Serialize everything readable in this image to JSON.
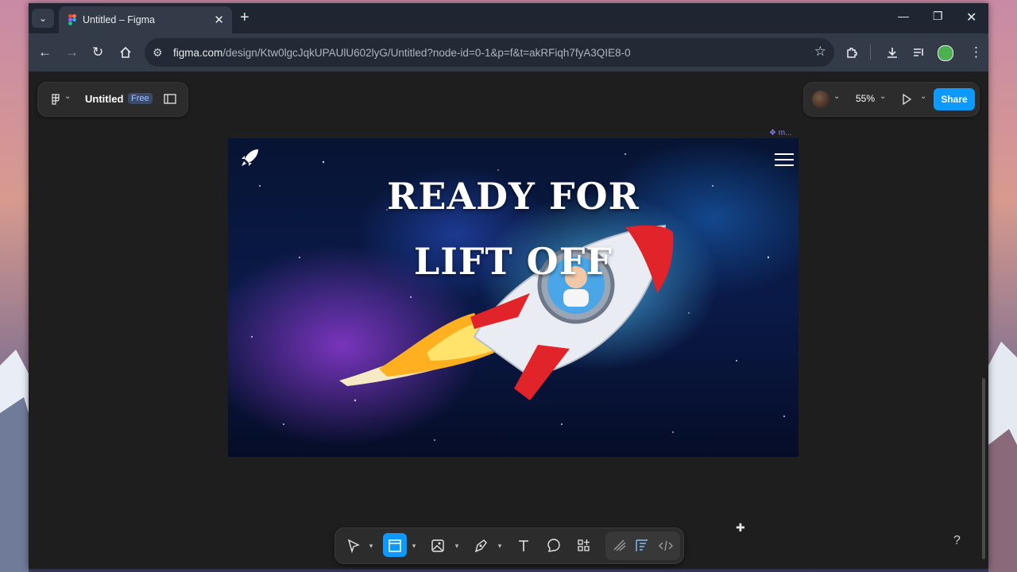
{
  "browser": {
    "tab_title": "Untitled – Figma",
    "url_host": "figma.com",
    "url_path": "/design/Ktw0lgcJqkUPAUlU602lyG/Untitled?node-id=0-1&p=f&t=akRFiqh7fyA3QIE8-0"
  },
  "figma": {
    "file_name": "Untitled",
    "plan_badge": "Free",
    "zoom": "55%",
    "share_label": "Share",
    "frame_label": "❖ m...",
    "help_label": "?"
  },
  "design": {
    "headline_line1": "READY FOR",
    "headline_line2": "LIFT OFF"
  },
  "colors": {
    "accent": "#0d99ff",
    "canvas": "#1e1e1e",
    "panel": "#2c2c2c"
  },
  "icons": [
    "tab-search-icon",
    "figma-favicon-icon",
    "close-tab-icon",
    "new-tab-icon",
    "minimize-icon",
    "restore-icon",
    "close-window-icon",
    "back-icon",
    "forward-icon",
    "reload-icon",
    "home-icon",
    "site-settings-icon",
    "bookmark-star-icon",
    "extensions-icon",
    "download-icon",
    "media-control-icon",
    "profile-avatar-icon",
    "chrome-menu-icon",
    "figma-main-menu-icon",
    "sidebar-toggle-icon",
    "present-play-icon",
    "move-tool-icon",
    "frame-tool-icon",
    "image-tool-icon",
    "pen-tool-icon",
    "text-tool-icon",
    "comment-tool-icon",
    "actions-icon",
    "draw-mode-icon",
    "design-mode-icon",
    "dev-mode-icon",
    "rocket-logo-icon",
    "hamburger-menu-icon"
  ]
}
